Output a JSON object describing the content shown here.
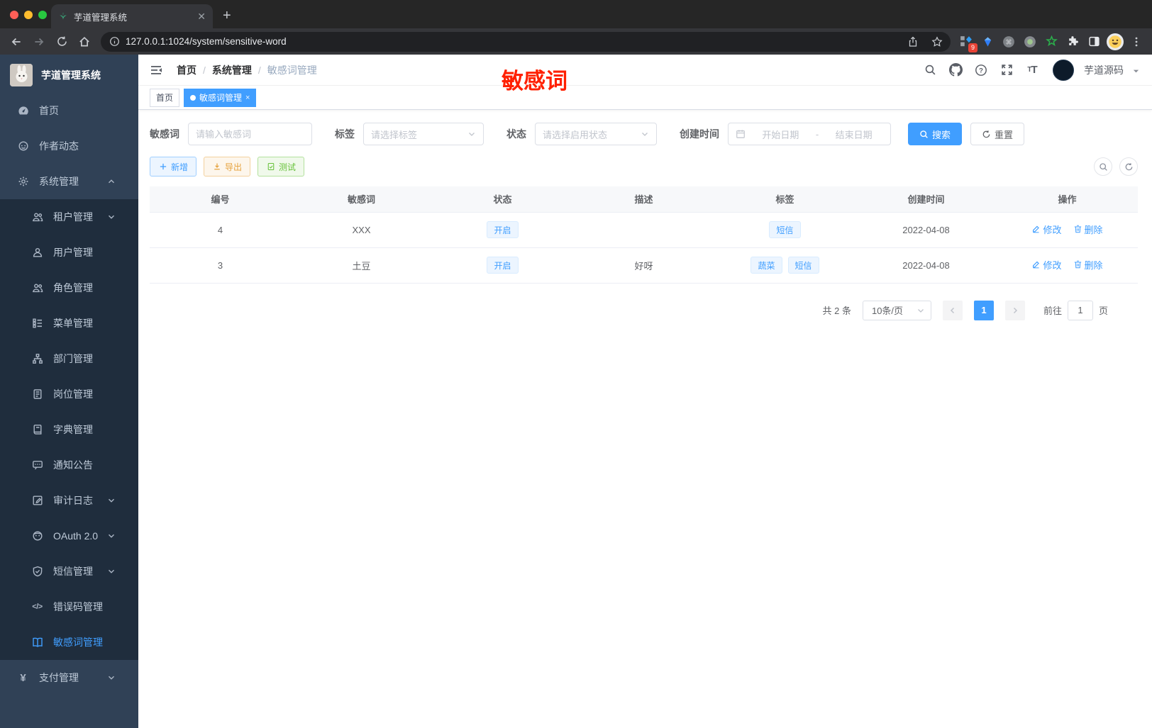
{
  "browser": {
    "tab_title": "芋道管理系统",
    "url": "127.0.0.1:1024/system/sensitive-word",
    "extension_badge": "9"
  },
  "sidebar": {
    "logo_title": "芋道管理系统",
    "items": [
      {
        "label": "首页",
        "icon": "dashboard",
        "level": 1
      },
      {
        "label": "作者动态",
        "icon": "author-feed",
        "level": 1
      },
      {
        "label": "系统管理",
        "icon": "gear",
        "level": 1,
        "chevron": "up"
      },
      {
        "label": "租户管理",
        "icon": "tenant",
        "level": 2,
        "chevron": "down"
      },
      {
        "label": "用户管理",
        "icon": "user",
        "level": 2
      },
      {
        "label": "角色管理",
        "icon": "role",
        "level": 2
      },
      {
        "label": "菜单管理",
        "icon": "menu-tree",
        "level": 2
      },
      {
        "label": "部门管理",
        "icon": "department",
        "level": 2
      },
      {
        "label": "岗位管理",
        "icon": "post-badge",
        "level": 2
      },
      {
        "label": "字典管理",
        "icon": "dictionary",
        "level": 2
      },
      {
        "label": "通知公告",
        "icon": "notice",
        "level": 2
      },
      {
        "label": "审计日志",
        "icon": "audit-log",
        "level": 2,
        "chevron": "down"
      },
      {
        "label": "OAuth 2.0",
        "icon": "oauth",
        "level": 2,
        "chevron": "down"
      },
      {
        "label": "短信管理",
        "icon": "sms-shield",
        "level": 2,
        "chevron": "down"
      },
      {
        "label": "错误码管理",
        "icon": "error-code",
        "level": 2
      },
      {
        "label": "敏感词管理",
        "icon": "sensitive-word",
        "level": 2,
        "active": true
      },
      {
        "label": "支付管理",
        "icon": "payment",
        "level": 1,
        "chevron": "down"
      }
    ]
  },
  "navbar": {
    "breadcrumb": [
      "首页",
      "系统管理",
      "敏感词管理"
    ],
    "username": "芋道源码"
  },
  "tags_view": {
    "tabs": [
      {
        "label": "首页",
        "active": false
      },
      {
        "label": "敏感词管理",
        "active": true,
        "closable": true
      }
    ]
  },
  "annotation": {
    "text": "敏感词",
    "color": "#ff2000"
  },
  "filters": {
    "word_label": "敏感词",
    "word_placeholder": "请输入敏感词",
    "tag_label": "标签",
    "tag_placeholder": "请选择标签",
    "status_label": "状态",
    "status_placeholder": "请选择启用状态",
    "time_label": "创建时间",
    "start_placeholder": "开始日期",
    "range_separator": "-",
    "end_placeholder": "结束日期",
    "search_label": "搜索",
    "reset_label": "重置"
  },
  "toolbar": {
    "add_label": "新增",
    "export_label": "导出",
    "test_label": "测试"
  },
  "table": {
    "columns": [
      "编号",
      "敏感词",
      "状态",
      "描述",
      "标签",
      "创建时间",
      "操作"
    ],
    "rows": [
      {
        "id": "4",
        "word": "XXX",
        "status": "开启",
        "desc": "",
        "tags": [
          "短信"
        ],
        "created": "2022-04-08"
      },
      {
        "id": "3",
        "word": "土豆",
        "status": "开启",
        "desc": "好呀",
        "tags": [
          "蔬菜",
          "短信"
        ],
        "created": "2022-04-08"
      }
    ],
    "edit_label": "修改",
    "delete_label": "删除"
  },
  "pagination": {
    "total": "共 2 条",
    "page_size": "10条/页",
    "current": "1",
    "goto_label": "前往",
    "goto_value": "1",
    "unit_label": "页"
  },
  "colors": {
    "primary": "#409eff",
    "sidebar": "#304156",
    "submenu": "#1f2d3d",
    "annotation_red": "#ff2000"
  }
}
